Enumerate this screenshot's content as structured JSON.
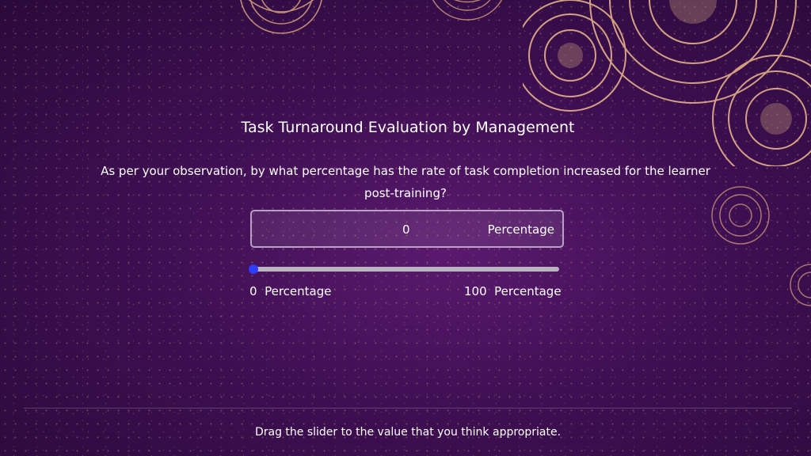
{
  "title": "Task Turnaround Evaluation by Management",
  "question": "As per your observation, by what percentage has the rate of task completion increased for the learner post-training?",
  "slider": {
    "value": "0",
    "unit": "Percentage",
    "min_label": "0  Percentage",
    "max_label": "100  Percentage",
    "fill_fraction": 0.0,
    "thumb_color": "#2e3dff"
  },
  "footer": "Drag the slider to the value that you think appropriate.",
  "colors": {
    "background": "#3e0f52",
    "ornament": "#e6b08a"
  }
}
